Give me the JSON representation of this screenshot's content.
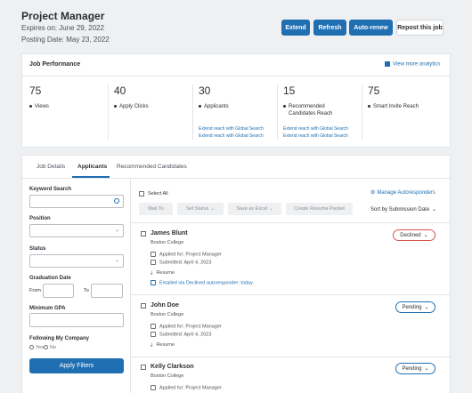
{
  "header": {
    "title": "Project Manager",
    "expires": "Expires on: June 29, 2022",
    "posting_date": "Posting Date: May 23, 2022",
    "buttons": {
      "extend": "Extend",
      "refresh": "Refresh",
      "auto_renew": "Auto-renew",
      "repost": "Repost this job"
    }
  },
  "performance": {
    "title": "Job Performance",
    "analytics_link": "View more analytics",
    "metrics": [
      {
        "value": "75",
        "label": "Views"
      },
      {
        "value": "40",
        "label": "Apply Clicks"
      },
      {
        "value": "30",
        "label": "Applicants",
        "links": [
          "Extend reach with Global Search",
          "Extend reach with Global Search"
        ]
      },
      {
        "value": "15",
        "label": "Recommended",
        "label2": "Candidates Reach",
        "links": [
          "Extend reach with Global Search",
          "Extend reach with Global Search"
        ]
      },
      {
        "value": "75",
        "label": "Smart Invite Reach"
      }
    ]
  },
  "tabs": [
    "Job Details",
    "Applicants",
    "Recommended Candidates"
  ],
  "filters": {
    "keyword_label": "Keyword Search",
    "position_label": "Position",
    "status_label": "Status",
    "grad_label": "Graduation Date",
    "from_label": "From",
    "to_label": "To",
    "gpa_label": "Minimum GPA",
    "following_label": "Following My Company",
    "yes": "Yes",
    "no": "No",
    "apply": "Apply Filters"
  },
  "toolbar": {
    "select_all": "Select All",
    "manage": "Manage Autoresponders",
    "mail_to": "Mail To",
    "set_status": "Set Status",
    "save_excel": "Save as Excel",
    "create_packet": "Create Resume Packet",
    "sort": "Sort by Submission Date"
  },
  "applicants": [
    {
      "name": "James Blunt",
      "school": "Boston College",
      "applied": "Applied for: Project Manager",
      "submitted": "Submitted: April 4, 2023",
      "resume": "Resume",
      "email_note": "Emailed via Declined autoresponder: today",
      "status": "Declined"
    },
    {
      "name": "John Doe",
      "school": "Boston College",
      "applied": "Applied for: Project Manager",
      "submitted": "Submitted: April 4, 2023",
      "resume": "Resume",
      "status": "Pending"
    },
    {
      "name": "Kelly Clarkson",
      "school": "Boston College",
      "applied": "Applied for: Project Manager",
      "status": "Pending"
    }
  ],
  "colors": {
    "primary": "#1f6fb2",
    "declined": "#d9534f",
    "link": "#1f6fb2"
  }
}
